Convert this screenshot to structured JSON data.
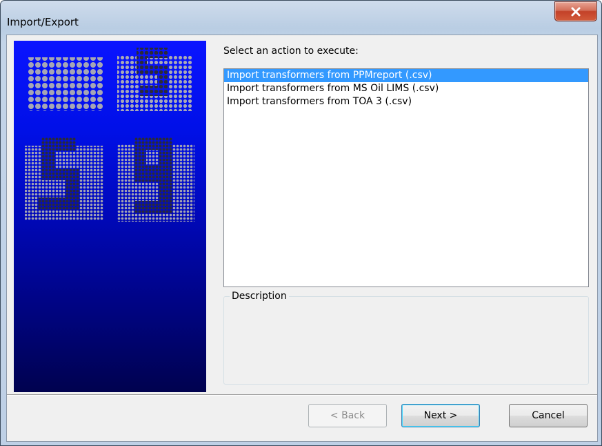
{
  "window": {
    "title": "Import/Export",
    "close_icon": "close-icon"
  },
  "main": {
    "prompt": "Select an action to execute:",
    "actions": [
      {
        "label": "Import transformers from PPMreport (.csv)",
        "selected": true
      },
      {
        "label": "Import transformers from MS Oil LIMS (.csv)",
        "selected": false
      },
      {
        "label": "Import transformers from TOA 3 (.csv)",
        "selected": false
      }
    ],
    "description_label": "Description",
    "description_text": ""
  },
  "footer": {
    "back_label": "< Back",
    "next_label": "Next >",
    "cancel_label": "Cancel"
  },
  "colors": {
    "selection": "#3399ff",
    "banner_top": "#0a14ff",
    "banner_bottom": "#00024f",
    "close_button": "#c34128"
  }
}
